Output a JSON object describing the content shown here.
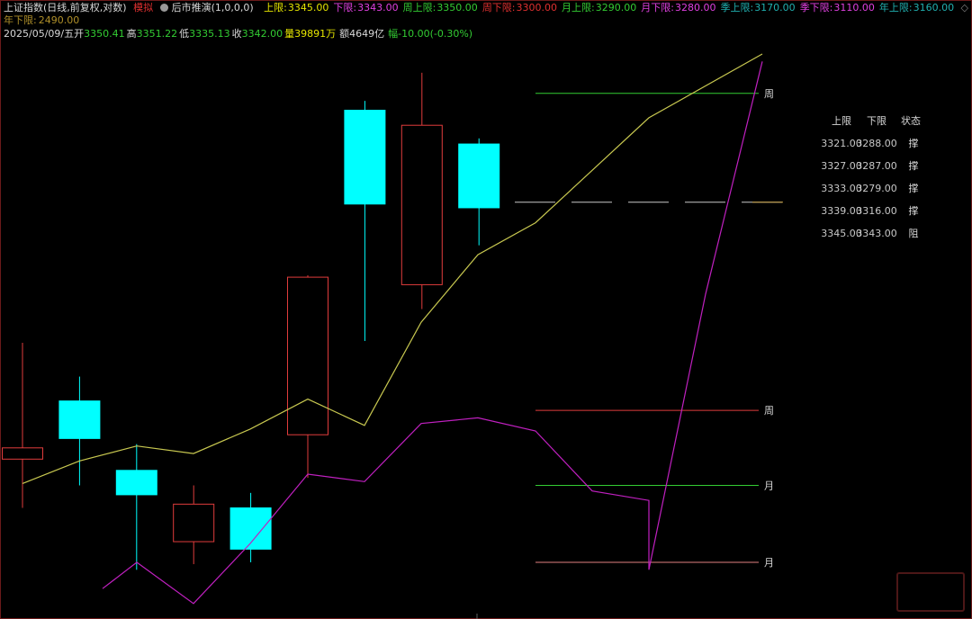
{
  "header": {
    "title": "上证指数(日线,前复权,对数)",
    "mode_badge": "模拟",
    "script_name": "后市推演(1,0,0,0)",
    "limits": [
      {
        "label": "上限:",
        "value": "3345.00",
        "color": "#e6e600"
      },
      {
        "label": "下限:",
        "value": "3343.00",
        "color": "#e040e0"
      },
      {
        "label": "周上限:",
        "value": "3350.00",
        "color": "#33cc33"
      },
      {
        "label": "周下限:",
        "value": "3300.00",
        "color": "#e03030"
      },
      {
        "label": "月上限:",
        "value": "3290.00",
        "color": "#33cc33"
      },
      {
        "label": "月下限:",
        "value": "3280.00",
        "color": "#e040e0"
      },
      {
        "label": "季上限:",
        "value": "3170.00",
        "color": "#20b0b0"
      },
      {
        "label": "季下限:",
        "value": "3110.00",
        "color": "#e040e0"
      },
      {
        "label": "年上限:",
        "value": "3160.00",
        "color": "#20b0b0"
      }
    ],
    "year_lower_label": "年下限:",
    "year_lower_value": "2490.00",
    "quote": {
      "date": "2025/05/09/五",
      "open_label": "开",
      "open": "3350.41",
      "high_label": "高",
      "high": "3351.22",
      "low_label": "低",
      "low": "3335.13",
      "close_label": "收",
      "close": "3342.00",
      "volume_label": "量",
      "volume": "39891万",
      "amount_label": "额",
      "amount": "4649亿",
      "change_label": "幅",
      "change": "-10.00(-0.30%)"
    }
  },
  "colors": {
    "background": "#000000",
    "up_candle": "#e03c3c",
    "down_candle": "#00ffff",
    "yellow_line": "#c8c850",
    "magenta_line": "#c020c0",
    "week_level": "#33cc33",
    "red_level": "#e03c3c",
    "month_level": "#33cc33",
    "month_low_level": "#e08080",
    "dashed_level": "#c8c8c8"
  },
  "chart_data": {
    "type": "candlestick",
    "y_axis_visible": false,
    "candles": [
      {
        "open": 3284,
        "close": 3290,
        "high": 3346,
        "low": 3258,
        "direction": "up"
      },
      {
        "open": 3315,
        "close": 3295,
        "high": 3328,
        "low": 3270,
        "direction": "down"
      },
      {
        "open": 3278,
        "close": 3265,
        "high": 3292,
        "low": 3225,
        "direction": "down"
      },
      {
        "open": 3240,
        "close": 3260,
        "high": 3270,
        "low": 3228,
        "direction": "up"
      },
      {
        "open": 3258,
        "close": 3236,
        "high": 3266,
        "low": 3229,
        "direction": "down"
      },
      {
        "open": 3297,
        "close": 3381,
        "high": 3382,
        "low": 3274,
        "direction": "up"
      },
      {
        "open": 3470,
        "close": 3420,
        "high": 3475,
        "low": 3347,
        "direction": "down"
      },
      {
        "open": 3377,
        "close": 3462,
        "high": 3490,
        "low": 3364,
        "direction": "up"
      },
      {
        "open": 3452,
        "close": 3418,
        "high": 3455,
        "low": 3398,
        "direction": "down"
      }
    ],
    "yellow_series": [
      3271,
      3283,
      3291,
      3287,
      3300,
      3316,
      3302,
      3357,
      3393,
      3410,
      3438,
      3466,
      3500
    ],
    "magenta_series": [
      3215,
      3229,
      3207,
      3239,
      3276,
      3272,
      3303,
      3306,
      3299,
      3267,
      3262,
      3225,
      3372,
      3496
    ],
    "levels": [
      {
        "label": "周",
        "value": 3479,
        "color": "#33cc33",
        "style": "solid"
      },
      {
        "label": "",
        "value": 3421,
        "color": "#c8c8c8",
        "style": "dashed"
      },
      {
        "label": "周",
        "value": 3310,
        "color": "#e03c3c",
        "style": "solid"
      },
      {
        "label": "月",
        "value": 3270,
        "color": "#33cc33",
        "style": "solid"
      },
      {
        "label": "月",
        "value": 3229,
        "color": "#e08080",
        "style": "solid"
      }
    ],
    "table": {
      "headers": [
        "上限",
        "下限",
        "状态"
      ],
      "rows": [
        [
          "3321.00",
          "3288.00",
          "撑"
        ],
        [
          "3327.00",
          "3287.00",
          "撑"
        ],
        [
          "3333.00",
          "3279.00",
          "撑"
        ],
        [
          "3339.00",
          "3316.00",
          "撑"
        ],
        [
          "3345.00",
          "3343.00",
          "阻"
        ]
      ]
    }
  }
}
